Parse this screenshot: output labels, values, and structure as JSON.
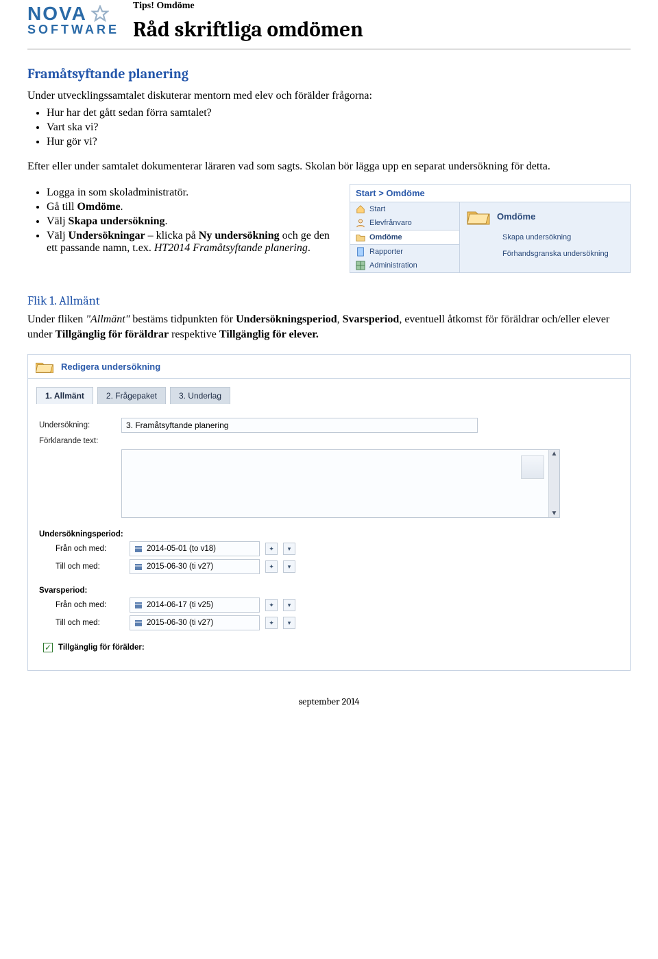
{
  "header": {
    "tips": "Tips! Omdöme",
    "title": "Råd skriftliga omdömen",
    "logo_nova": "NOVA",
    "logo_software": "SOFTWARE"
  },
  "intro": {
    "heading": "Framåtsyftande planering",
    "lead": "Under utvecklingssamtalet diskuterar mentorn med elev och förälder frågorna:",
    "questions": [
      "Hur har det gått sedan förra samtalet?",
      "Vart ska vi?",
      "Hur gör vi?"
    ],
    "para2": "Efter eller under samtalet dokumenterar läraren vad som sagts. Skolan bör lägga upp en separat undersökning för detta."
  },
  "steps": [
    "Logga in som skoladministratör.",
    "Gå till <b>Omdöme</b>.",
    "Välj <b>Skapa undersökning</b>.",
    "Välj <b>Undersökningar</b> – klicka på <b>Ny undersökning</b> och ge den ett passande namn, t.ex. <i>HT2014 Framåtsyftande planering</i>."
  ],
  "nav_panel": {
    "breadcrumb": "Start > Omdöme",
    "col1": [
      {
        "icon": "house",
        "label": "Start"
      },
      {
        "icon": "face",
        "label": "Elevfrånvaro"
      },
      {
        "icon": "fold",
        "label": "Omdöme",
        "bold": true
      },
      {
        "icon": "doc",
        "label": "Rapporter"
      },
      {
        "icon": "grid",
        "label": "Administration"
      }
    ],
    "col2": {
      "title": "Omdöme",
      "links": [
        "Skapa undersökning",
        "Förhandsgranska undersökning"
      ]
    }
  },
  "flik1": {
    "heading": "Flik 1. Allmänt",
    "text_parts": {
      "p1a": "Under fliken ",
      "p1b": " bestäms tidpunkten för ",
      "p1c": ", ",
      "p1d": ", eventuell åtkomst för föräldrar och/eller elever under ",
      "p1e": " respektive ",
      "i_allmant": "\"Allmänt\"",
      "b_up": "Undersökningsperiod",
      "b_sp": "Svarsperiod",
      "b_tf": "Tillgänglig för föräldrar",
      "b_te": "Tillgänglig för elever."
    }
  },
  "form_panel": {
    "title": "Redigera undersökning",
    "tabs": [
      "1. Allmänt",
      "2. Frågepaket",
      "3. Underlag"
    ],
    "labels": {
      "undersokning": "Undersökning:",
      "forklarande": "Förklarande text:",
      "undersokningsperiod": "Undersökningsperiod:",
      "svarsperiod": "Svarsperiod:",
      "fran": "Från och med:",
      "till": "Till och med:",
      "tillganglig_foralder": "Tillgänglig för förälder:"
    },
    "values": {
      "undersokning": "3. Framåtsyftande planering",
      "up_from": "2014-05-01 (to v18)",
      "up_to": "2015-06-30 (ti v27)",
      "sp_from": "2014-06-17 (ti v25)",
      "sp_to": "2015-06-30 (ti v27)"
    }
  },
  "footer": "september 2014"
}
